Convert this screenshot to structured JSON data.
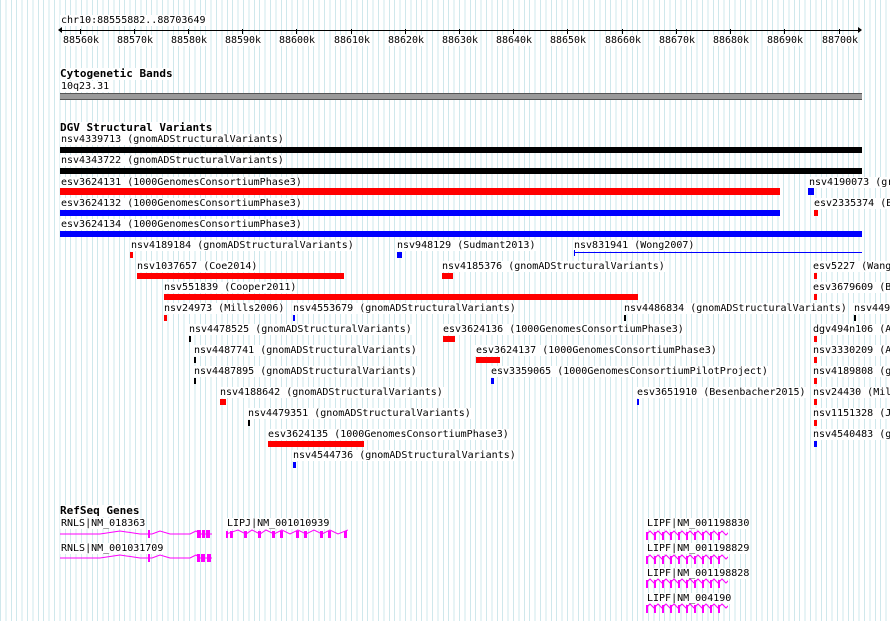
{
  "ruler": {
    "region": "chr10:88555882..88703649",
    "ticks": [
      "88560k",
      "88570k",
      "88580k",
      "88590k",
      "88600k",
      "88610k",
      "88620k",
      "88630k",
      "88640k",
      "88650k",
      "88660k",
      "88670k",
      "88680k",
      "88690k",
      "88700k"
    ]
  },
  "cytoband": {
    "title": "Cytogenetic Bands",
    "band": "10q23.31"
  },
  "dgv": {
    "title": "DGV Structural Variants",
    "features": [
      {
        "label": "nsv4339713 (gnomADStructuralVariants)",
        "color": "#000000"
      },
      {
        "label": "nsv4343722 (gnomADStructuralVariants)",
        "color": "#000000"
      },
      {
        "label": "esv3624131 (1000GenomesConsortiumPhase3)",
        "color": "#ff0000"
      },
      {
        "label": "esv3624132 (1000GenomesConsortiumPhase3)",
        "color": "#0000ff"
      },
      {
        "label": "esv3624134 (1000GenomesConsortiumPhase3)",
        "color": "#0000ff"
      },
      {
        "label": "nsv4190073 (gr",
        "color": "#0000ff"
      },
      {
        "label": "esv2335374 (B",
        "color": "#ff0000"
      },
      {
        "label": "nsv4189184 (gnomADStructuralVariants)",
        "color": "#ff0000"
      },
      {
        "label": "nsv948129 (Sudmant2013)",
        "color": "#0000ff"
      },
      {
        "label": "nsv831941 (Wong2007)",
        "color": "#0000ff"
      },
      {
        "label": "nsv1037657 (Coe2014)",
        "color": "#ff0000"
      },
      {
        "label": "nsv4185376 (gnomADStructuralVariants)",
        "color": "#ff0000"
      },
      {
        "label": "esv5227 (Wang",
        "color": "#ff0000"
      },
      {
        "label": "nsv551839 (Cooper2011)",
        "color": "#ff0000"
      },
      {
        "label": "esv3679609 (B",
        "color": "#ff0000"
      },
      {
        "label": "nsv24973 (Mills2006)",
        "color": "#ff0000"
      },
      {
        "label": "nsv4553679 (gnomADStructuralVariants)",
        "color": "#0000ff"
      },
      {
        "label": "nsv4486834 (gnomADStructuralVariants)",
        "color": "#000000"
      },
      {
        "label": "nsv449",
        "color": "#000000"
      },
      {
        "label": "nsv4478525 (gnomADStructuralVariants)",
        "color": "#000000"
      },
      {
        "label": "esv3624136 (1000GenomesConsortiumPhase3)",
        "color": "#ff0000"
      },
      {
        "label": "dgv494n106 (A",
        "color": "#ff0000"
      },
      {
        "label": "nsv4487741 (gnomADStructuralVariants)",
        "color": "#000000"
      },
      {
        "label": "esv3624137 (1000GenomesConsortiumPhase3)",
        "color": "#ff0000"
      },
      {
        "label": "nsv3330209 (A",
        "color": "#ff0000"
      },
      {
        "label": "nsv4487895 (gnomADStructuralVariants)",
        "color": "#000000"
      },
      {
        "label": "esv3359065 (1000GenomesConsortiumPilotProject)",
        "color": "#0000ff"
      },
      {
        "label": "nsv4189808 (g",
        "color": "#ff0000"
      },
      {
        "label": "nsv4188642 (gnomADStructuralVariants)",
        "color": "#ff0000"
      },
      {
        "label": "esv3651910 (Besenbacher2015)",
        "color": "#0000ff"
      },
      {
        "label": "nsv24430 (Mil",
        "color": "#ff0000"
      },
      {
        "label": "nsv4479351 (gnomADStructuralVariants)",
        "color": "#000000"
      },
      {
        "label": "nsv1151328 (J",
        "color": "#ff0000"
      },
      {
        "label": "esv3624135 (1000GenomesConsortiumPhase3)",
        "color": "#ff0000"
      },
      {
        "label": "nsv4540483 (g",
        "color": "#0000ff"
      },
      {
        "label": "nsv4544736 (gnomADStructuralVariants)",
        "color": "#0000ff"
      }
    ]
  },
  "refseq": {
    "title": "RefSeq Genes",
    "color": "#ff00ff",
    "genes": [
      {
        "label": "RNLS|NM_018363"
      },
      {
        "label": "LIPJ|NM_001010939"
      },
      {
        "label": "RNLS|NM_001031709"
      },
      {
        "label": "LIPF|NM_001198830"
      },
      {
        "label": "LIPF|NM_001198829"
      },
      {
        "label": "LIPF|NM_001198828"
      },
      {
        "label": "LIPF|NM_004190"
      }
    ]
  }
}
